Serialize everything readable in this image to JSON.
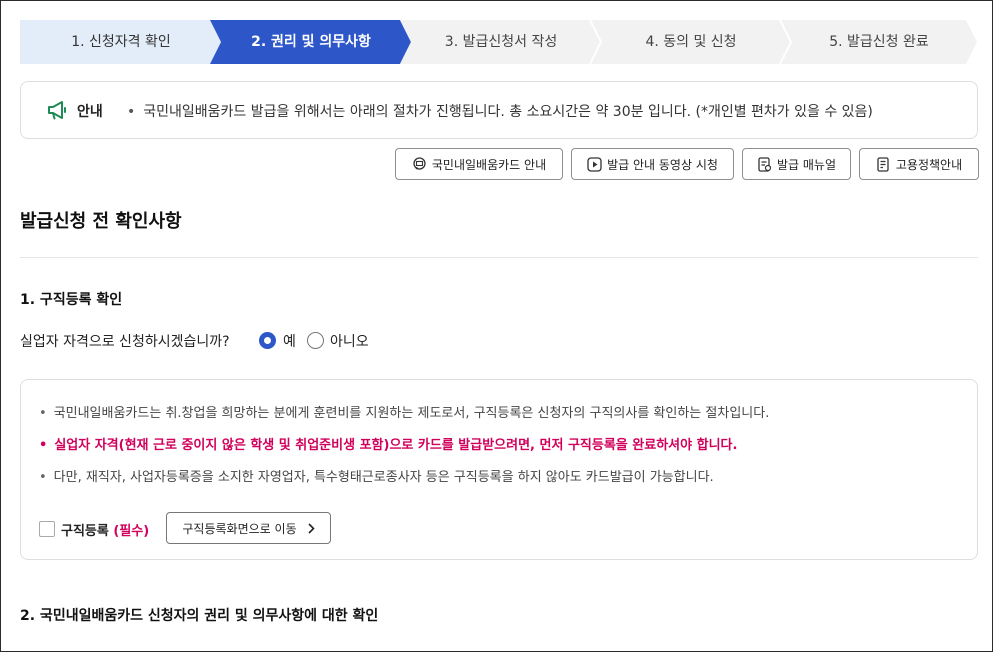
{
  "stepper": {
    "steps": [
      {
        "label": "1. 신청자격 확인",
        "state": "done"
      },
      {
        "label": "2. 권리 및 의무사항",
        "state": "active"
      },
      {
        "label": "3. 발급신청서 작성",
        "state": "todo"
      },
      {
        "label": "4. 동의 및 신청",
        "state": "todo"
      },
      {
        "label": "5. 발급신청 완료",
        "state": "todo"
      }
    ],
    "colors": {
      "done": "#e3edf9",
      "active": "#2d57c9",
      "todo": "#f2f2f2"
    }
  },
  "notice": {
    "icon": "megaphone-icon",
    "title": "안내",
    "text": "국민내일배움카드 발급을 위해서는 아래의 절차가 진행됩니다. 총 소요시간은 약 30분 입니다. (*개인별 편차가 있을 수 있음)"
  },
  "guide_buttons": [
    {
      "label": "국민내일배움카드 안내",
      "icon": "card-info-icon"
    },
    {
      "label": "발급 안내 동영상 시청",
      "icon": "play-icon"
    },
    {
      "label": "발급 매뉴얼",
      "icon": "manual-icon"
    },
    {
      "label": "고용정책안내",
      "icon": "policy-doc-icon"
    }
  ],
  "main": {
    "title": "발급신청 전 확인사항",
    "section1": {
      "title": "1. 구직등록 확인",
      "question": "실업자 자격으로 신청하시겠습니까?",
      "options": [
        {
          "label": "예",
          "selected": true
        },
        {
          "label": "아니오",
          "selected": false
        }
      ],
      "bullets": [
        {
          "text": "국민내일배움카드는 취.창업을 희망하는 분에게 훈련비를 지원하는 제도로서, 구직등록은 신청자의 구직의사를 확인하는 절차입니다.",
          "alert": false
        },
        {
          "text": "실업자 자격(현재 근로 중이지 않은 학생 및 취업준비생 포함)으로 카드를 발급받으려면, 먼저 구직등록을 완료하셔야 합니다.",
          "alert": true
        },
        {
          "text": "다만, 재직자, 사업자등록증을 소지한 자영업자, 특수형태근로종사자 등은 구직등록을 하지 않아도 카드발급이 가능합니다.",
          "alert": false
        }
      ],
      "checkbox_label": "구직등록",
      "checkbox_required": "(필수)",
      "checkbox_checked": false,
      "move_button": "구직등록화면으로 이동"
    },
    "section2": {
      "title": "2. 국민내일배움카드 신청자의 권리 및 의무사항에 대한 확인"
    }
  },
  "accent_colors": {
    "primary": "#2d57c9",
    "alert": "#d1005b",
    "notice_icon": "#1e8a55"
  }
}
